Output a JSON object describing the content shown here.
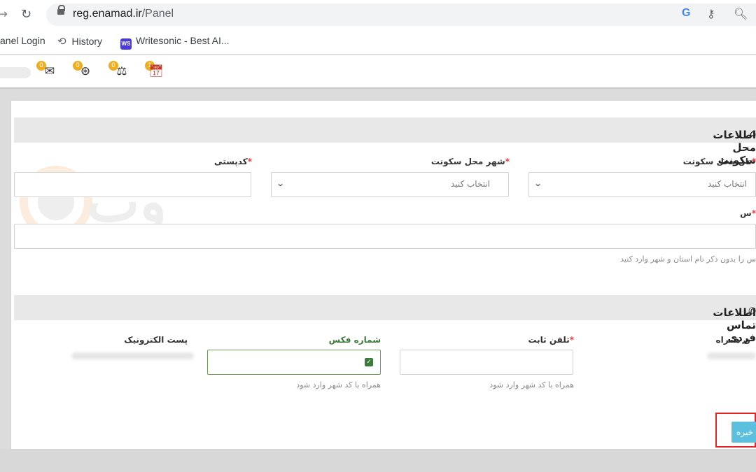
{
  "browser": {
    "url_host": "reg.enamad.ir",
    "url_path": "/Panel",
    "google_letter": "G",
    "bookmarks": [
      {
        "label": "anel Login"
      },
      {
        "label": "History"
      },
      {
        "label": "Writesonic - Best AI..."
      }
    ],
    "writesonic_icon_text": "WS"
  },
  "toolbar": {
    "badges": [
      "0",
      "0",
      "0",
      "1"
    ]
  },
  "section_residence": {
    "title": "اطلاعات محل سکونت",
    "province_label": "تان محل سکونت",
    "province_placeholder": "انتخاب کنید",
    "city_label": "شهر محل سکونت",
    "city_placeholder": "انتخاب کنید",
    "postal_label": "کدپستی",
    "address_label": "س",
    "address_help": "س را بدون ذکر نام استان و شهر وارد کنید",
    "required_mark": "*"
  },
  "section_contact": {
    "title": "اطلاعات تماس فردی",
    "mobile_label": "ن همراه",
    "phone_label": "تلفن ثابت",
    "phone_help": "همراه با کد شهر وارد شود",
    "fax_label": "شماره فکس",
    "fax_help": "همراه با کد شهر وارد شود",
    "email_label": "پست الکترونیک",
    "required_mark": "*"
  },
  "actions": {
    "save_label": "خیره"
  },
  "colors": {
    "accent_button": "#5bc0de",
    "required": "#e04040",
    "highlight": "#e02525",
    "badge": "#f0ad1e",
    "fax_border": "#6a9d5a"
  }
}
